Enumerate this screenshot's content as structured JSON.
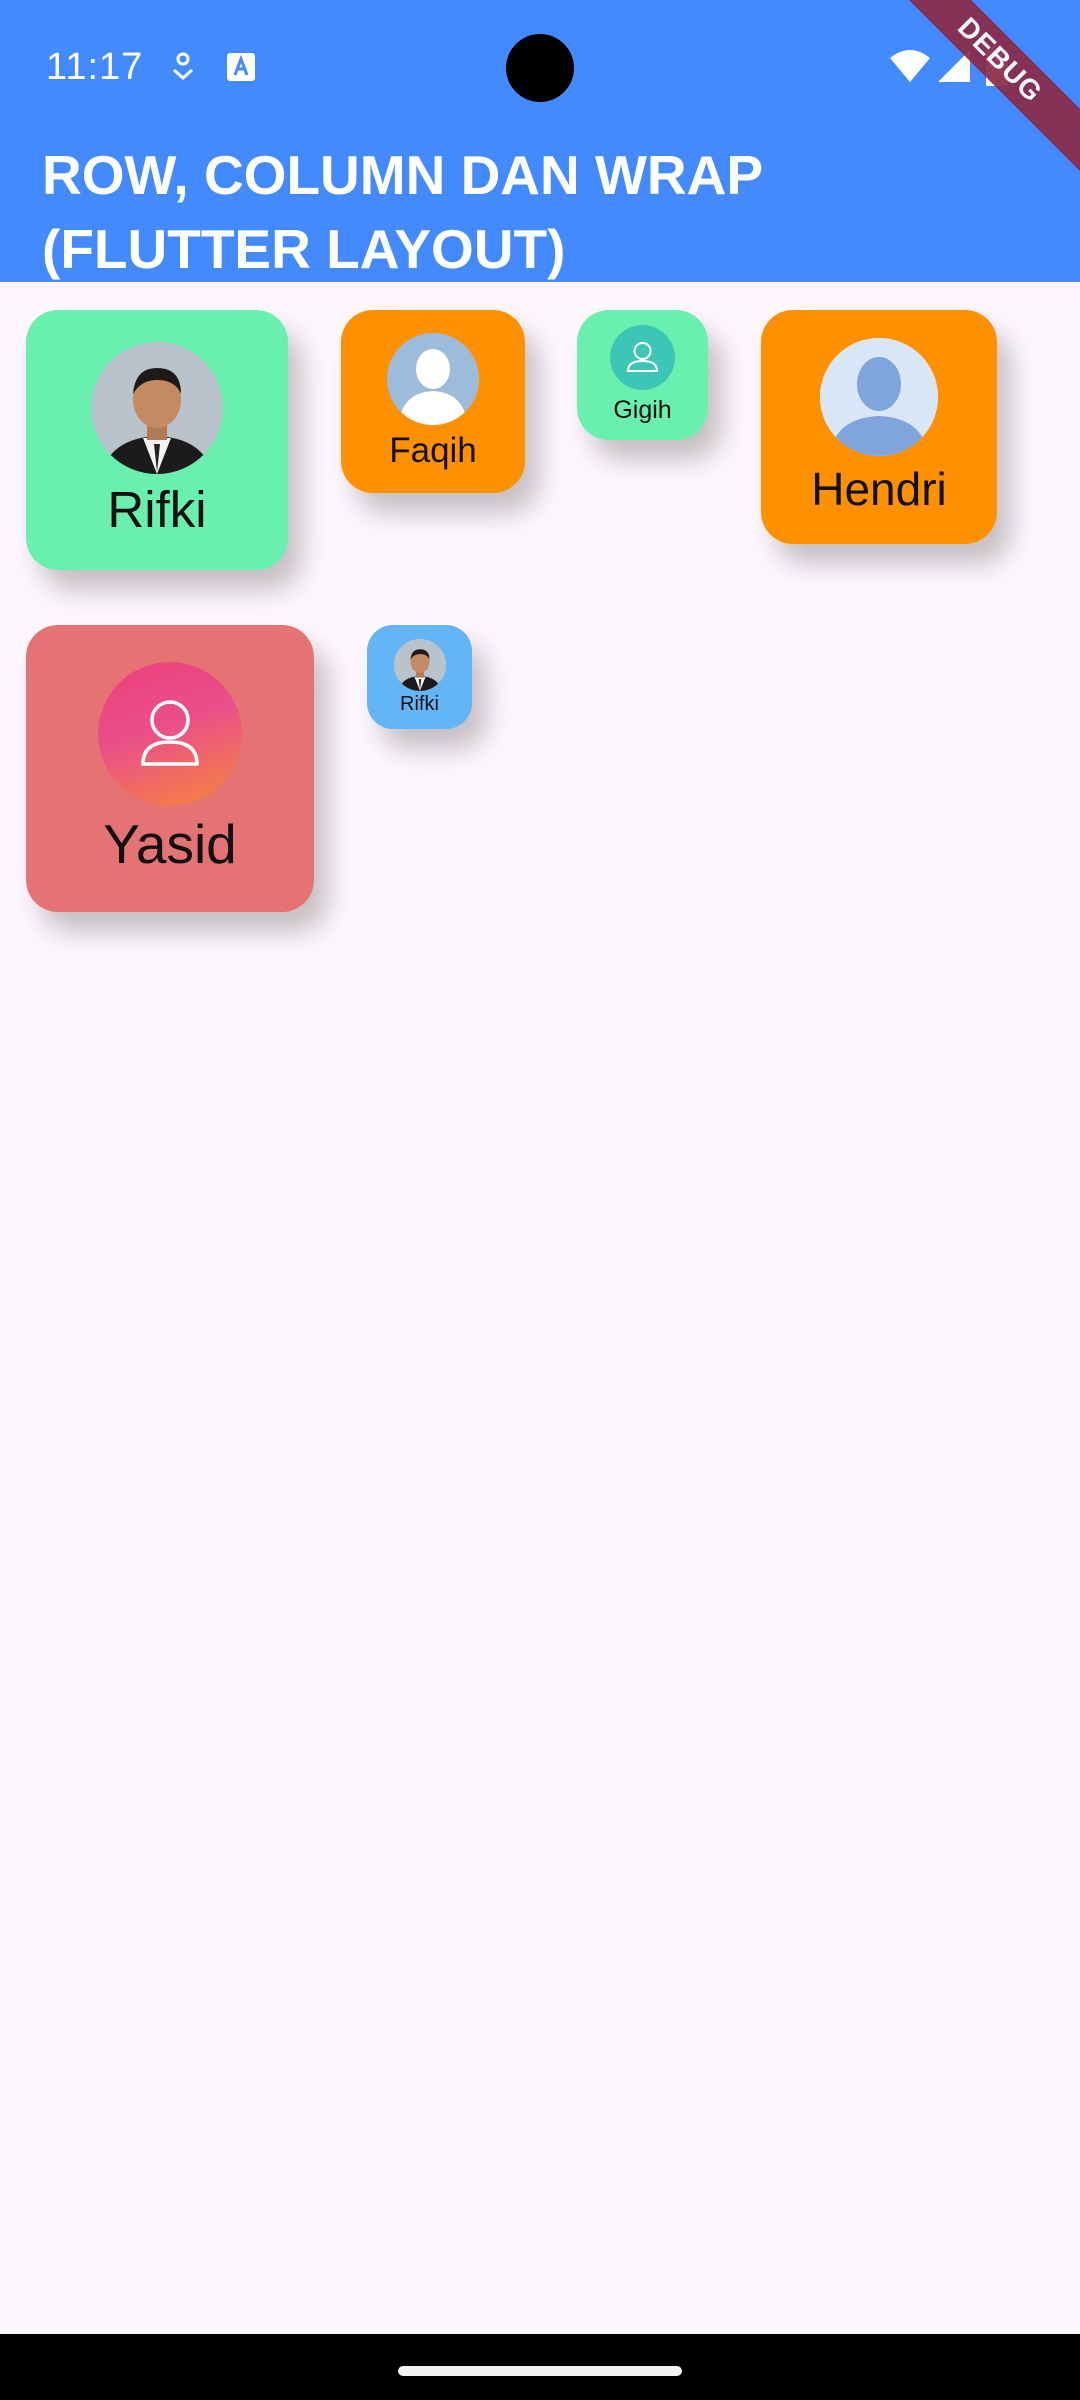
{
  "status_bar": {
    "time": "11:17",
    "icons": [
      "location-download-icon",
      "text-a-icon",
      "wifi-icon",
      "signal-icon",
      "battery-icon"
    ]
  },
  "app_bar": {
    "title": "ROW, COLUMN DAN WRAP\n(FLUTTER LAYOUT)",
    "color": "#448aff",
    "debug_banner": "DEBUG"
  },
  "cards": [
    {
      "name": "Rifki",
      "color": "#69f0ae",
      "avatar": "photo-portrait-icon"
    },
    {
      "name": "Faqih",
      "color": "#ff9100",
      "avatar": "default-person-silhouette-icon"
    },
    {
      "name": "Gigih",
      "color": "#69f0ae",
      "avatar": "person-outline-icon"
    },
    {
      "name": "Hendri",
      "color": "#ff9100",
      "avatar": "blue-person-silhouette-icon"
    },
    {
      "name": "Yasid",
      "color": "#e57373",
      "avatar": "gradient-person-outline-icon"
    },
    {
      "name": "Rifki",
      "color": "#64b5f6",
      "avatar": "photo-portrait-icon"
    }
  ]
}
